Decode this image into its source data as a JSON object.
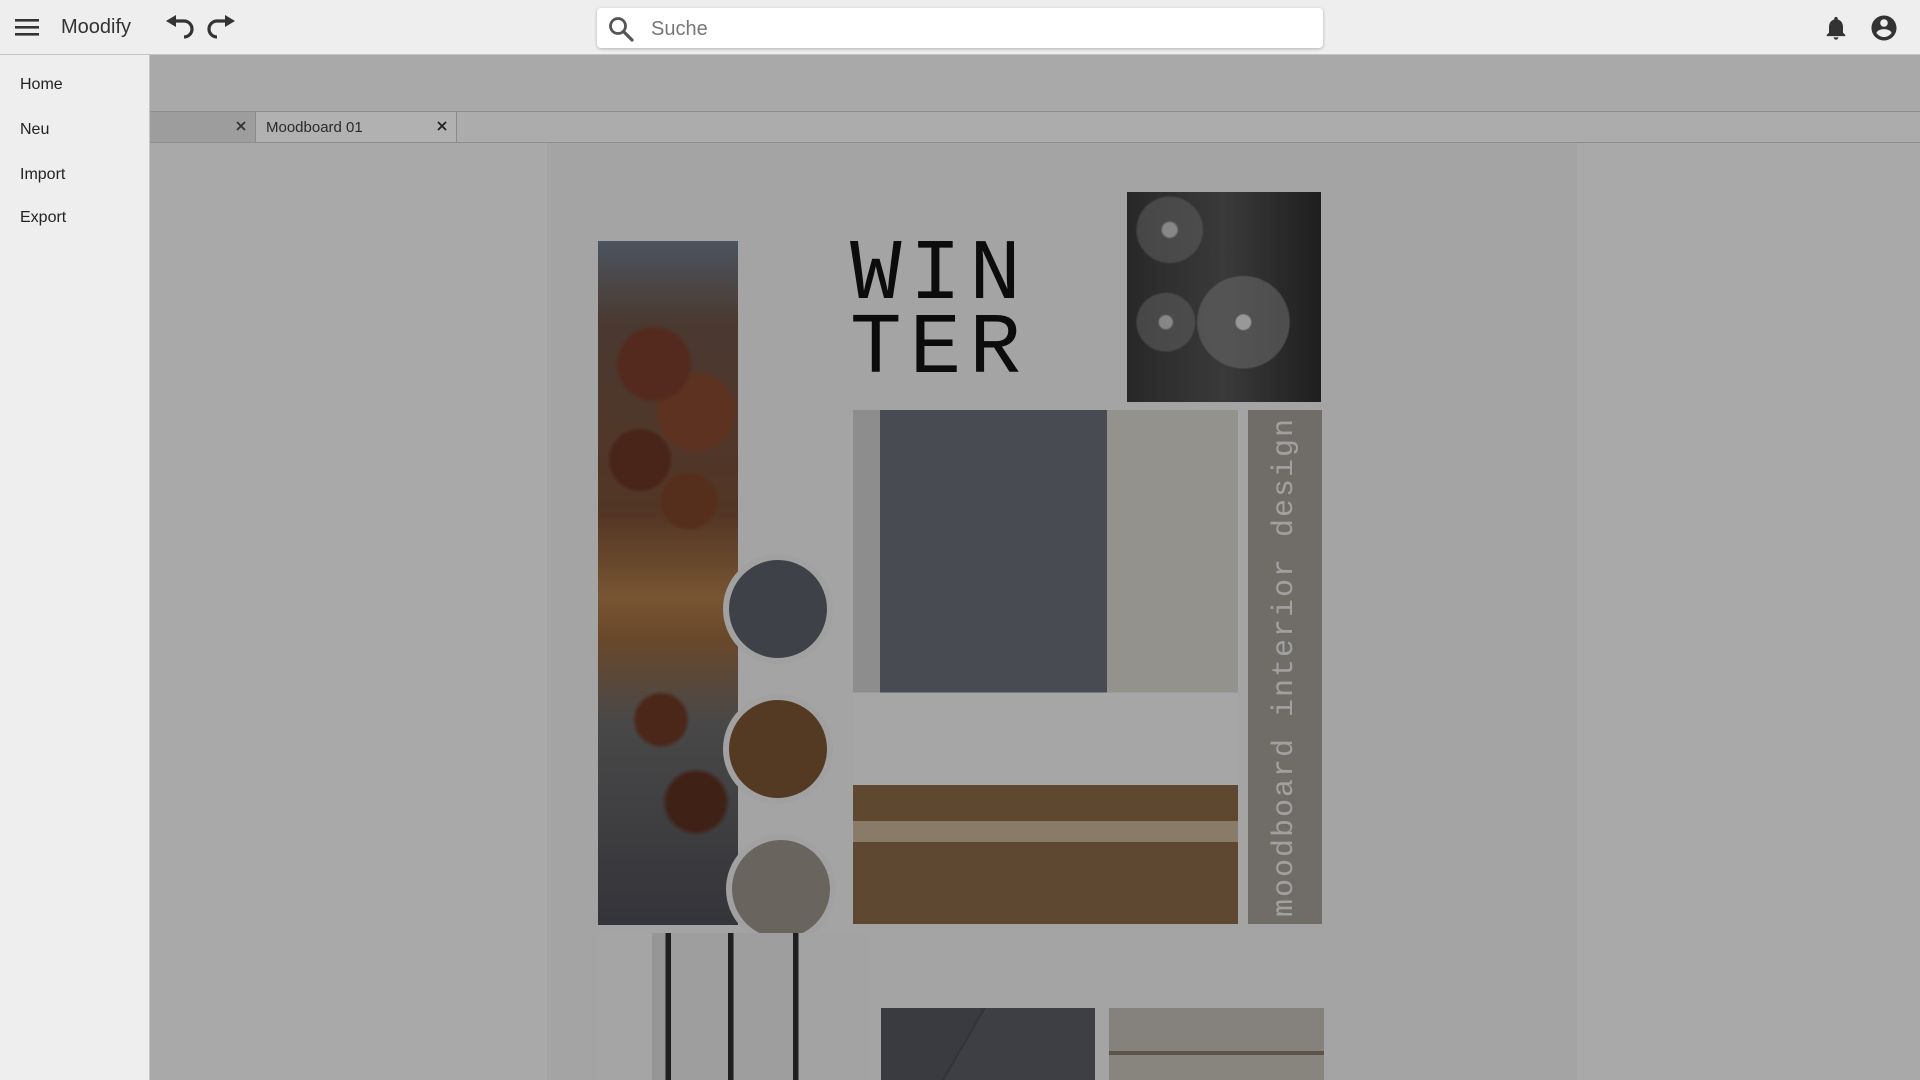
{
  "app": {
    "title": "Moodify"
  },
  "search": {
    "placeholder": "Suche",
    "value": ""
  },
  "sidebar": {
    "items": [
      {
        "label": "Home"
      },
      {
        "label": "Neu"
      },
      {
        "label": "Import"
      },
      {
        "label": "Export"
      }
    ]
  },
  "tabs": [
    {
      "label": ""
    },
    {
      "label": "Moodboard 01"
    }
  ],
  "moodboard": {
    "title": "WIN\nTER",
    "subtitle": "moodboard interior design",
    "swatches": [
      "#5b6069",
      "#7b5634",
      "#9b948a"
    ]
  },
  "icons": {
    "menu": "hamburger-icon",
    "undo": "undo-icon",
    "redo": "redo-icon",
    "search": "search-icon",
    "bell": "bell-icon",
    "account": "account-circle-icon",
    "close": "close-icon"
  }
}
